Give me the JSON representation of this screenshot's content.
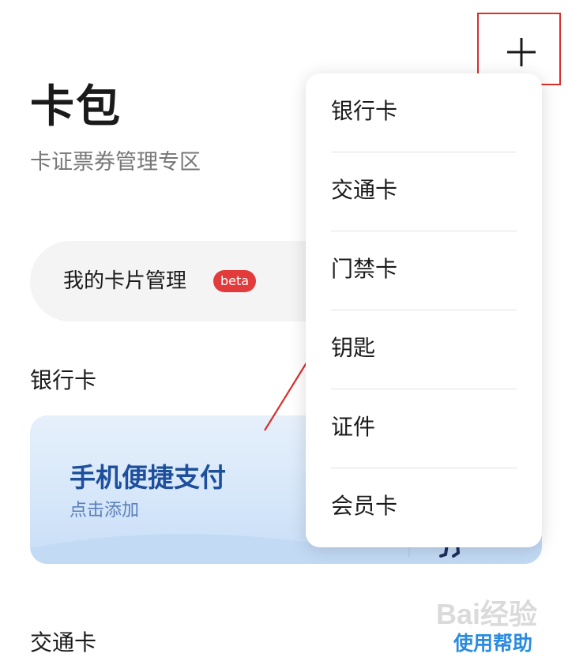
{
  "header": {
    "title": "卡包",
    "subtitle": "卡证票券管理专区"
  },
  "add_button": {
    "icon": "plus-icon"
  },
  "card_management": {
    "label": "我的卡片管理",
    "badge": "beta"
  },
  "sections": {
    "bank": "银行卡",
    "transit": "交通卡"
  },
  "bank_banner": {
    "title": "手机便捷支付",
    "subtitle": "点击添加"
  },
  "help_link": "使用帮助",
  "watermark": "Bai经验",
  "dropdown": {
    "items": [
      {
        "label": "银行卡"
      },
      {
        "label": "交通卡"
      },
      {
        "label": "门禁卡"
      },
      {
        "label": "钥匙"
      },
      {
        "label": "证件"
      },
      {
        "label": "会员卡"
      }
    ]
  },
  "colors": {
    "highlight": "#d9302c",
    "badge": "#e23b3b",
    "link": "#2a8be0",
    "banner_title": "#1e4f9c"
  }
}
